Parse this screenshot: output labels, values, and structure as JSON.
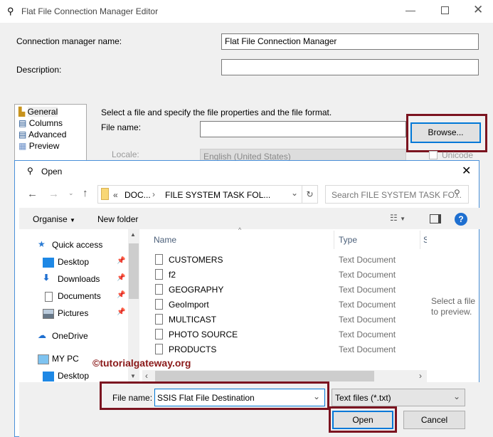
{
  "editor": {
    "title": "Flat File Connection Manager Editor",
    "conn_name_label": "Connection manager name:",
    "conn_name_value": "Flat File Connection Manager",
    "description_label": "Description:",
    "description_value": "",
    "sidebar": [
      {
        "label": "General"
      },
      {
        "label": "Columns"
      },
      {
        "label": "Advanced"
      },
      {
        "label": "Preview"
      }
    ],
    "instruction": "Select a file and specify the file properties and the file format.",
    "file_name_label": "File name:",
    "file_name_value": "",
    "browse_label": "Browse...",
    "locale_label": "Locale:",
    "locale_value": "English (United States)",
    "unicode_label": "Unicode"
  },
  "dialog": {
    "title": "Open",
    "breadcrumb": [
      "«",
      "DOC...",
      "FILE SYSTEM TASK FOL..."
    ],
    "search_placeholder": "Search FILE SYSTEM TASK FO...",
    "organise_label": "Organise",
    "new_folder_label": "New folder",
    "nav": [
      {
        "label": "Quick access",
        "icon": "star-icon"
      },
      {
        "label": "Desktop",
        "icon": "desktop-icon",
        "pinned": true
      },
      {
        "label": "Downloads",
        "icon": "download-icon",
        "pinned": true
      },
      {
        "label": "Documents",
        "icon": "documents-icon",
        "pinned": true
      },
      {
        "label": "Pictures",
        "icon": "pictures-icon",
        "pinned": true
      },
      {
        "label": "OneDrive",
        "icon": "cloud-icon"
      },
      {
        "label": "MY PC",
        "icon": "pc-icon"
      },
      {
        "label": "Desktop",
        "icon": "desktop-icon"
      }
    ],
    "columns": {
      "name": "Name",
      "type": "Type",
      "size": "S"
    },
    "files": [
      {
        "name": "CUSTOMERS",
        "type": "Text Document"
      },
      {
        "name": "f2",
        "type": "Text Document"
      },
      {
        "name": "GEOGRAPHY",
        "type": "Text Document"
      },
      {
        "name": "GeoImport",
        "type": "Text Document"
      },
      {
        "name": "MULTICAST",
        "type": "Text Document"
      },
      {
        "name": "PHOTO SOURCE",
        "type": "Text Document"
      },
      {
        "name": "PRODUCTS",
        "type": "Text Document"
      }
    ],
    "preview_text": "Select a file to preview.",
    "file_name_label": "File name:",
    "file_name_value": "SSIS Flat File Destination",
    "file_type_value": "Text files (*.txt)",
    "open_label": "Open",
    "cancel_label": "Cancel"
  },
  "watermark": "©tutorialgateway.org"
}
